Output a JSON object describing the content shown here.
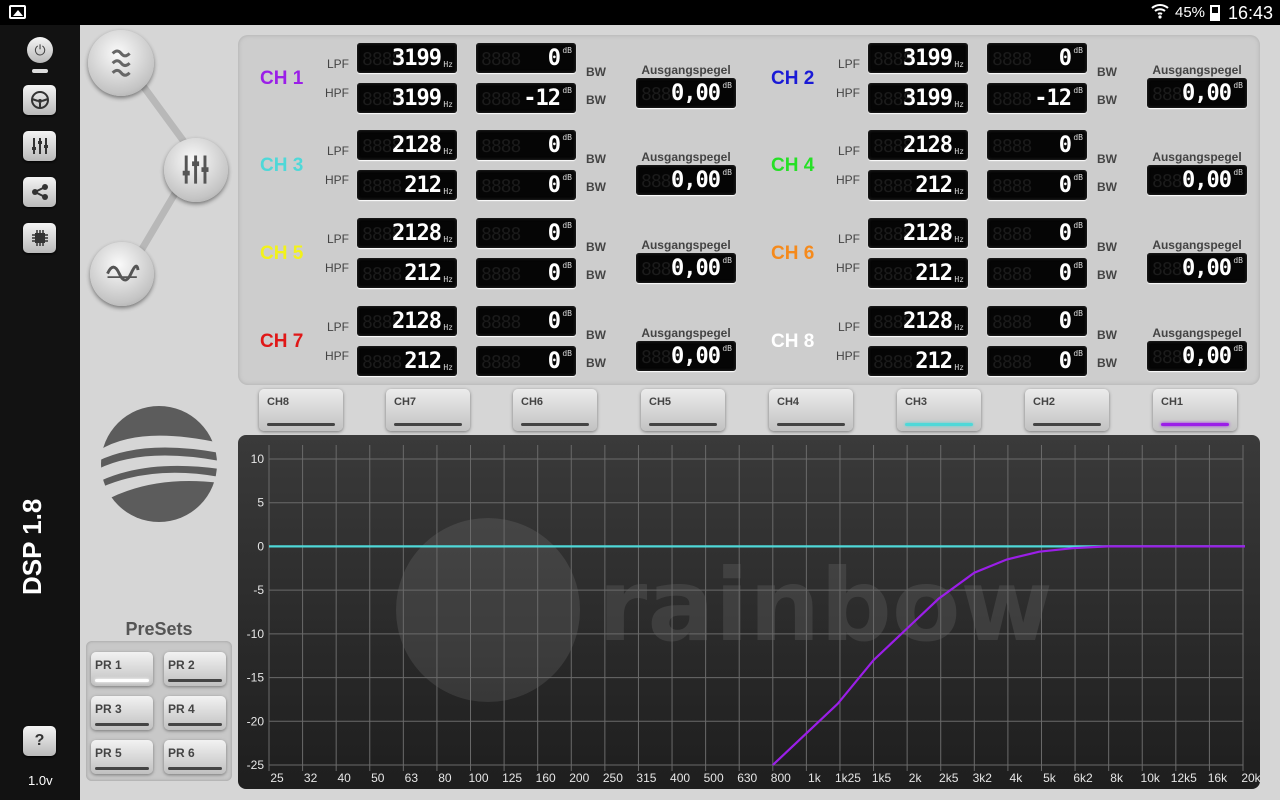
{
  "status_bar": {
    "battery": "45%",
    "time": "16:43",
    "icons": [
      "gallery-icon",
      "wifi-icon",
      "battery-icon"
    ]
  },
  "sidebar": {
    "title": "DSP 1.8",
    "version": "1.0v",
    "help_label": "?",
    "buttons": [
      "power-icon",
      "steering-wheel-icon",
      "mixer-sliders-icon",
      "routing-icon",
      "chip-icon"
    ]
  },
  "nav": {
    "buttons": [
      "filter-icon",
      "equalizer-icon",
      "waveform-icon"
    ]
  },
  "presets": {
    "title": "PreSets",
    "items": [
      {
        "label": "PR 1",
        "active": true
      },
      {
        "label": "PR 2",
        "active": false
      },
      {
        "label": "PR 3",
        "active": false
      },
      {
        "label": "PR 4",
        "active": false
      },
      {
        "label": "PR 5",
        "active": false
      },
      {
        "label": "PR 6",
        "active": false
      }
    ]
  },
  "labels": {
    "lpf": "LPF",
    "hpf": "HPF",
    "bw": "BW",
    "output": "Ausgangspegel",
    "hz": "Hz",
    "db": "dB"
  },
  "channels": [
    {
      "name": "CH 1",
      "color": "#9b1ee8",
      "lpf": "3199",
      "lpf_db": "0",
      "hpf": "3199",
      "hpf_db": "-12",
      "out": "0,00"
    },
    {
      "name": "CH 2",
      "color": "#1a1ad6",
      "lpf": "3199",
      "lpf_db": "0",
      "hpf": "3199",
      "hpf_db": "-12",
      "out": "0,00"
    },
    {
      "name": "CH 3",
      "color": "#4fd8d8",
      "lpf": "2128",
      "lpf_db": "0",
      "hpf": "212",
      "hpf_db": "0",
      "out": "0,00"
    },
    {
      "name": "CH 4",
      "color": "#26e026",
      "lpf": "2128",
      "lpf_db": "0",
      "hpf": "212",
      "hpf_db": "0",
      "out": "0,00"
    },
    {
      "name": "CH 5",
      "color": "#f2f21a",
      "lpf": "2128",
      "lpf_db": "0",
      "hpf": "212",
      "hpf_db": "0",
      "out": "0,00"
    },
    {
      "name": "CH 6",
      "color": "#f58a1c",
      "lpf": "2128",
      "lpf_db": "0",
      "hpf": "212",
      "hpf_db": "0",
      "out": "0,00"
    },
    {
      "name": "CH 7",
      "color": "#e01818",
      "lpf": "2128",
      "lpf_db": "0",
      "hpf": "212",
      "hpf_db": "0",
      "out": "0,00"
    },
    {
      "name": "CH 8",
      "color": "#ffffff",
      "lpf": "2128",
      "lpf_db": "0",
      "hpf": "212",
      "hpf_db": "0",
      "out": "0,00"
    }
  ],
  "tabs": [
    {
      "label": "CH8",
      "active": false,
      "color": "#444444"
    },
    {
      "label": "CH7",
      "active": false,
      "color": "#444444"
    },
    {
      "label": "CH6",
      "active": false,
      "color": "#444444"
    },
    {
      "label": "CH5",
      "active": false,
      "color": "#444444"
    },
    {
      "label": "CH4",
      "active": false,
      "color": "#444444"
    },
    {
      "label": "CH3",
      "active": true,
      "color": "#4fd8d8"
    },
    {
      "label": "CH2",
      "active": false,
      "color": "#444444"
    },
    {
      "label": "CH1",
      "active": true,
      "color": "#9b1ee8"
    }
  ],
  "chart_data": {
    "type": "line",
    "xscale": "log",
    "x_tick_labels": [
      "25",
      "32",
      "40",
      "50",
      "63",
      "80",
      "100",
      "125",
      "160",
      "200",
      "250",
      "315",
      "400",
      "500",
      "630",
      "800",
      "1k",
      "1k25",
      "1k5",
      "2k",
      "2k5",
      "3k2",
      "4k",
      "5k",
      "6k2",
      "8k",
      "10k",
      "12k5",
      "16k",
      "20k"
    ],
    "y_tick_labels": [
      "10",
      "5",
      "0",
      "-5",
      "-10",
      "-15",
      "-20",
      "-25"
    ],
    "ylim": [
      -25,
      10
    ],
    "grid": true,
    "watermark": "rainbow",
    "series": [
      {
        "color": "#4fd8d8",
        "x": [
          25,
          25000
        ],
        "y": [
          0,
          0
        ]
      },
      {
        "color": "#9b1ee8",
        "x": [
          800,
          1000,
          1250,
          1600,
          2000,
          2500,
          3200,
          4000,
          5000,
          6300,
          8000,
          10000,
          25000
        ],
        "y": [
          -25,
          -21.5,
          -18,
          -13,
          -9.5,
          -6,
          -3,
          -1.5,
          -0.6,
          -0.2,
          0,
          0,
          0
        ]
      }
    ]
  }
}
